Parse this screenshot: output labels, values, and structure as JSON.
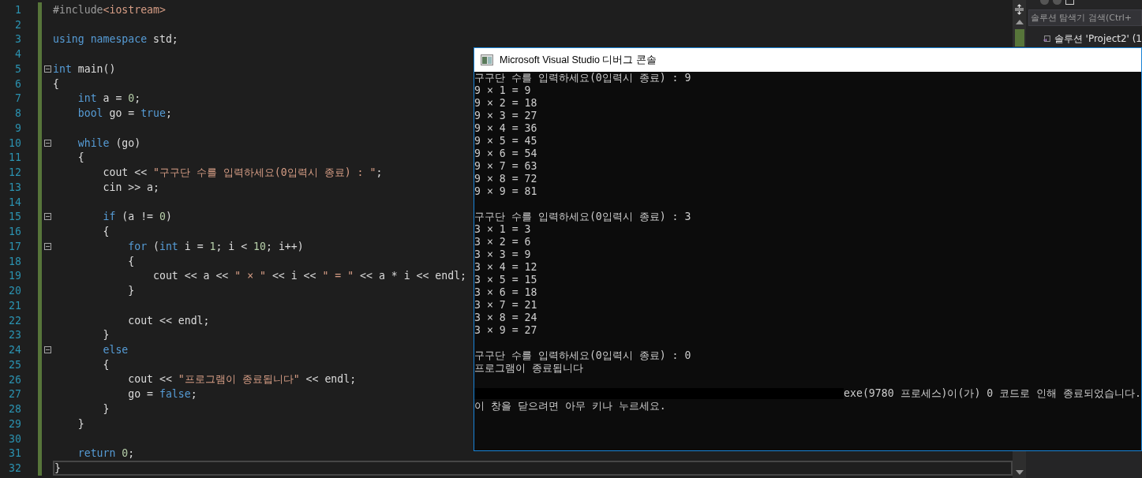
{
  "editor": {
    "code_lines": [
      {
        "n": "1",
        "tokens": [
          {
            "kind": "pre",
            "text": "#include"
          },
          {
            "kind": "str",
            "text": "<iostream>"
          }
        ],
        "fold": false,
        "current": false
      },
      {
        "n": "2",
        "fold": false,
        "current": false
      },
      {
        "n": "3",
        "tokens": [
          {
            "kind": "kw",
            "text": "using"
          },
          {
            "kind": "kw",
            "text": " namespace"
          },
          {
            "kind": "plain",
            "text": " std;"
          }
        ],
        "fold": false,
        "current": false
      },
      {
        "n": "4",
        "fold": false,
        "current": false
      },
      {
        "n": "5",
        "tokens": [
          {
            "kind": "kw",
            "text": "int"
          },
          {
            "kind": "plain",
            "text": " main()"
          }
        ],
        "fold": true,
        "current": false
      },
      {
        "n": "6",
        "tokens": [
          {
            "kind": "plain",
            "text": "{"
          }
        ],
        "fold": false,
        "current": false
      },
      {
        "n": "7",
        "tokens": [
          {
            "kind": "kw",
            "text": "    int"
          },
          {
            "kind": "plain",
            "text": " a = "
          },
          {
            "kind": "num",
            "text": "0"
          },
          {
            "kind": "plain",
            "text": ";"
          }
        ],
        "fold": false,
        "current": false
      },
      {
        "n": "8",
        "tokens": [
          {
            "kind": "kw",
            "text": "    bool"
          },
          {
            "kind": "plain",
            "text": " go = "
          },
          {
            "kind": "kw",
            "text": "true"
          },
          {
            "kind": "plain",
            "text": ";"
          }
        ],
        "fold": false,
        "current": false
      },
      {
        "n": "9",
        "fold": false,
        "current": false
      },
      {
        "n": "10",
        "tokens": [
          {
            "kind": "kw",
            "text": "    while"
          },
          {
            "kind": "plain",
            "text": " (go)"
          }
        ],
        "fold": true,
        "current": false
      },
      {
        "n": "11",
        "tokens": [
          {
            "kind": "plain",
            "text": "    {"
          }
        ],
        "fold": false,
        "current": false
      },
      {
        "n": "12",
        "tokens": [
          {
            "kind": "plain",
            "text": "        cout << "
          },
          {
            "kind": "str",
            "text": "\"구구단 수를 입력하세요(0입력시 종료) : \""
          },
          {
            "kind": "plain",
            "text": ";"
          }
        ],
        "fold": false,
        "current": false
      },
      {
        "n": "13",
        "tokens": [
          {
            "kind": "plain",
            "text": "        cin >> a;"
          }
        ],
        "fold": false,
        "current": false
      },
      {
        "n": "14",
        "fold": false,
        "current": false
      },
      {
        "n": "15",
        "tokens": [
          {
            "kind": "kw",
            "text": "        if"
          },
          {
            "kind": "plain",
            "text": " (a != "
          },
          {
            "kind": "num",
            "text": "0"
          },
          {
            "kind": "plain",
            "text": ")"
          }
        ],
        "fold": true,
        "current": false
      },
      {
        "n": "16",
        "tokens": [
          {
            "kind": "plain",
            "text": "        {"
          }
        ],
        "fold": false,
        "current": false
      },
      {
        "n": "17",
        "tokens": [
          {
            "kind": "kw",
            "text": "            for"
          },
          {
            "kind": "plain",
            "text": " ("
          },
          {
            "kind": "kw",
            "text": "int"
          },
          {
            "kind": "plain",
            "text": " i = "
          },
          {
            "kind": "num",
            "text": "1"
          },
          {
            "kind": "plain",
            "text": "; i < "
          },
          {
            "kind": "num",
            "text": "10"
          },
          {
            "kind": "plain",
            "text": "; i++)"
          }
        ],
        "fold": true,
        "current": false
      },
      {
        "n": "18",
        "tokens": [
          {
            "kind": "plain",
            "text": "            {"
          }
        ],
        "fold": false,
        "current": false
      },
      {
        "n": "19",
        "tokens": [
          {
            "kind": "plain",
            "text": "                cout << a << "
          },
          {
            "kind": "str",
            "text": "\" × \""
          },
          {
            "kind": "plain",
            "text": " << i << "
          },
          {
            "kind": "str",
            "text": "\" = \""
          },
          {
            "kind": "plain",
            "text": " << a * i << endl;"
          }
        ],
        "fold": false,
        "current": false
      },
      {
        "n": "20",
        "tokens": [
          {
            "kind": "plain",
            "text": "            }"
          }
        ],
        "fold": false,
        "current": false
      },
      {
        "n": "21",
        "fold": false,
        "current": false
      },
      {
        "n": "22",
        "tokens": [
          {
            "kind": "plain",
            "text": "            cout << endl;"
          }
        ],
        "fold": false,
        "current": false
      },
      {
        "n": "23",
        "tokens": [
          {
            "kind": "plain",
            "text": "        }"
          }
        ],
        "fold": false,
        "current": false
      },
      {
        "n": "24",
        "tokens": [
          {
            "kind": "kw",
            "text": "        else"
          }
        ],
        "fold": true,
        "current": false
      },
      {
        "n": "25",
        "tokens": [
          {
            "kind": "plain",
            "text": "        {"
          }
        ],
        "fold": false,
        "current": false
      },
      {
        "n": "26",
        "tokens": [
          {
            "kind": "plain",
            "text": "            cout << "
          },
          {
            "kind": "str",
            "text": "\"프로그램이 종료됩니다\""
          },
          {
            "kind": "plain",
            "text": " << endl;"
          }
        ],
        "fold": false,
        "current": false
      },
      {
        "n": "27",
        "tokens": [
          {
            "kind": "plain",
            "text": "            go = "
          },
          {
            "kind": "kw",
            "text": "false"
          },
          {
            "kind": "plain",
            "text": ";"
          }
        ],
        "fold": false,
        "current": false
      },
      {
        "n": "28",
        "tokens": [
          {
            "kind": "plain",
            "text": "        }"
          }
        ],
        "fold": false,
        "current": false
      },
      {
        "n": "29",
        "tokens": [
          {
            "kind": "plain",
            "text": "    }"
          }
        ],
        "fold": false,
        "current": false
      },
      {
        "n": "30",
        "fold": false,
        "current": false
      },
      {
        "n": "31",
        "tokens": [
          {
            "kind": "kw",
            "text": "    return"
          },
          {
            "kind": "num",
            "text": " 0"
          },
          {
            "kind": "plain",
            "text": ";"
          }
        ],
        "fold": false,
        "current": false
      },
      {
        "n": "32",
        "tokens": [
          {
            "kind": "plain",
            "text": "}"
          }
        ],
        "fold": false,
        "current": true
      }
    ]
  },
  "solution_explorer": {
    "search": {
      "placeholder": "솔루션 탐색기 검색(Ctrl+"
    },
    "items": [
      {
        "label": "솔루션 'Project2' (1"
      }
    ]
  },
  "console_window": {
    "title": "Microsoft Visual Studio 디버그 콘솔",
    "lines": [
      {
        "kind": "text",
        "text": "구구단 수를 입력하세요(0입력시 종료) : 9"
      },
      {
        "kind": "text",
        "text": "9 × 1 = 9"
      },
      {
        "kind": "text",
        "text": "9 × 2 = 18"
      },
      {
        "kind": "text",
        "text": "9 × 3 = 27"
      },
      {
        "kind": "text",
        "text": "9 × 4 = 36"
      },
      {
        "kind": "text",
        "text": "9 × 5 = 45"
      },
      {
        "kind": "text",
        "text": "9 × 6 = 54"
      },
      {
        "kind": "text",
        "text": "9 × 7 = 63"
      },
      {
        "kind": "text",
        "text": "9 × 8 = 72"
      },
      {
        "kind": "text",
        "text": "9 × 9 = 81"
      },
      {
        "kind": "blank"
      },
      {
        "kind": "text",
        "text": "구구단 수를 입력하세요(0입력시 종료) : 3"
      },
      {
        "kind": "text",
        "text": "3 × 1 = 3"
      },
      {
        "kind": "text",
        "text": "3 × 2 = 6"
      },
      {
        "kind": "text",
        "text": "3 × 3 = 9"
      },
      {
        "kind": "text",
        "text": "3 × 4 = 12"
      },
      {
        "kind": "text",
        "text": "3 × 5 = 15"
      },
      {
        "kind": "text",
        "text": "3 × 6 = 18"
      },
      {
        "kind": "text",
        "text": "3 × 7 = 21"
      },
      {
        "kind": "text",
        "text": "3 × 8 = 24"
      },
      {
        "kind": "text",
        "text": "3 × 9 = 27"
      },
      {
        "kind": "blank"
      },
      {
        "kind": "text",
        "text": "구구단 수를 입력하세요(0입력시 종료) : 0"
      },
      {
        "kind": "text",
        "text": "프로그램이 종료됩니다"
      },
      {
        "kind": "blank"
      },
      {
        "kind": "redacted",
        "text": "exe(9780 프로세스)이(가) 0 코드로 인해 종료되었습니다."
      },
      {
        "kind": "text",
        "text": "이 창을 닫으려면 아무 키나 누르세요."
      }
    ]
  }
}
